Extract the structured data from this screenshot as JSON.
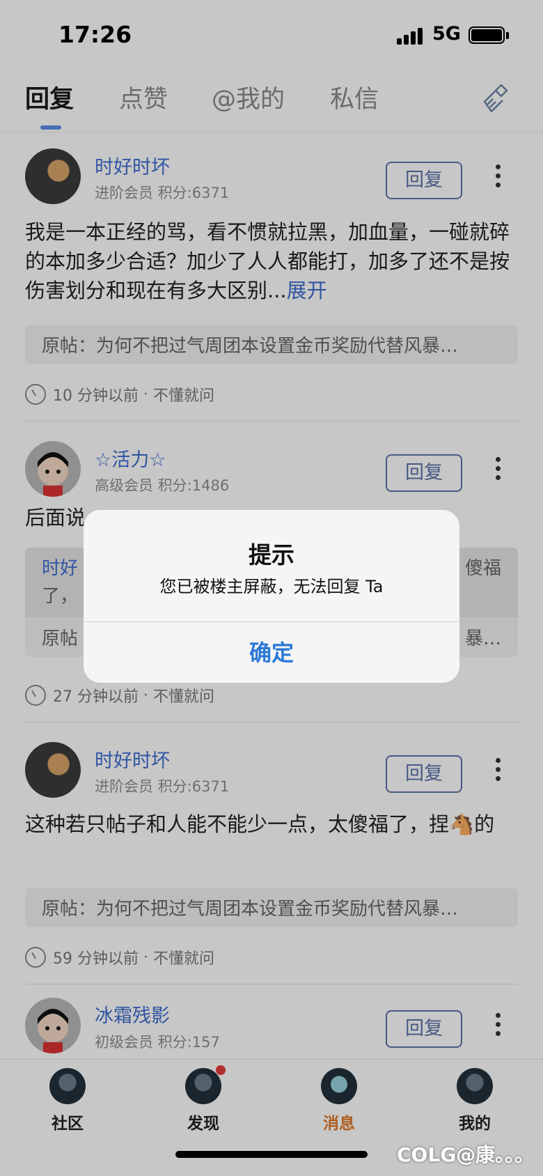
{
  "status_bar": {
    "time": "17:26",
    "network": "5G"
  },
  "tabs": [
    {
      "label": "回复",
      "active": true
    },
    {
      "label": "点赞",
      "active": false
    },
    {
      "label": "@我的",
      "active": false
    },
    {
      "label": "私信",
      "active": false
    }
  ],
  "posts": [
    {
      "username": "时好时坏",
      "level": "进阶会员",
      "points": "积分:6371",
      "reply_label": "回复",
      "content": "我是一本正经的骂，看不惯就拉黑，加血量，一碰就碎的本加多少合适？加少了人人都能打，加多了还不是按伤害划分和现在有多大区别...",
      "expand_label": "展开",
      "quote": "原帖：为何不把过气周团本设置金币奖励代替风暴…",
      "time": "10 分钟以前",
      "tag": "不懂就问"
    },
    {
      "username": "☆活力☆",
      "level": "高级会员",
      "points": "积分:1486",
      "reply_label": "回复",
      "content": "后面说",
      "quoted_reply_user": "时好",
      "quoted_reply_tail": "傻福",
      "quoted_reply_line2": "了，",
      "quote": "原帖",
      "quote_tail": "暴…",
      "time": "27 分钟以前",
      "tag": "不懂就问"
    },
    {
      "username": "时好时坏",
      "level": "进阶会员",
      "points": "积分:6371",
      "reply_label": "回复",
      "content": "这种若只帖子和人能不能少一点，太傻福了，捏🐴的",
      "quote": "原帖：为何不把过气周团本设置金币奖励代替风暴…",
      "time": "59 分钟以前",
      "tag": "不懂就问"
    },
    {
      "username": "冰霜残影",
      "level": "初级会员",
      "points": "积分:157",
      "reply_label": "回复"
    }
  ],
  "dialog": {
    "title": "提示",
    "message": "您已被楼主屏蔽，无法回复 Ta",
    "confirm_label": "确定"
  },
  "bottom_nav": [
    {
      "label": "社区",
      "icon": "community-icon",
      "active": false
    },
    {
      "label": "发现",
      "icon": "discover-icon",
      "active": false,
      "badge": true
    },
    {
      "label": "消息",
      "icon": "messages-icon",
      "active": true
    },
    {
      "label": "我的",
      "icon": "profile-icon",
      "active": false
    }
  ],
  "watermark": "COLG@康。。。",
  "colors": {
    "link": "#3f6ed1",
    "active_nav": "#e07a2a",
    "dialog_button": "#2c78d6"
  }
}
